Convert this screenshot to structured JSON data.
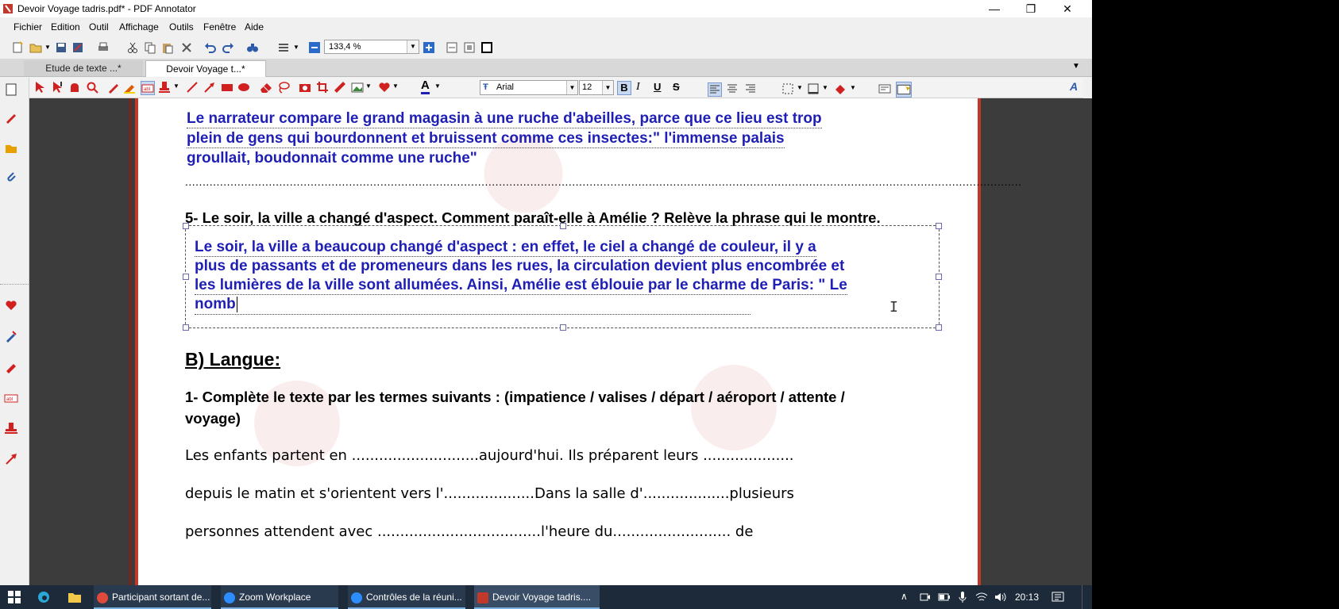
{
  "window": {
    "title": "Devoir Voyage tadris.pdf* - PDF Annotator",
    "minimize": "—",
    "restore": "❐",
    "close": "✕"
  },
  "menu": [
    "Fichier",
    "Edition",
    "Outil",
    "Affichage",
    "Outils",
    "Fenêtre",
    "Aide"
  ],
  "toolbar": {
    "zoom_value": "133,4 %"
  },
  "tabs": [
    {
      "label": "Etude de texte ...*",
      "active": false
    },
    {
      "label": "Devoir Voyage t...*",
      "active": true
    }
  ],
  "format_toolbar": {
    "font": "Arial",
    "size": "12",
    "bold": "B",
    "italic": "I",
    "underline": "U",
    "strike": "S",
    "text_color": "A",
    "right_icon": "A"
  },
  "document": {
    "answer4": [
      "Le narrateur compare le grand magasin à une ruche d'abeilles, parce que ce lieu est trop",
      "plein de gens qui bourdonnent et bruissent comme ces insectes:\" l'immense palais",
      "groullait, boudonnait comme une ruche\""
    ],
    "answer4_dots": "................................................................................................................................................................................................................................................",
    "q5": "5- Le soir, la ville a changé d'aspect. Comment paraît-elle à Amélie ? Relève la phrase qui le montre.",
    "answer5": [
      "Le soir, la ville a beaucoup changé d'aspect : en effet, le ciel a changé de couleur, il y a",
      "plus de passants et de promeneurs dans les rues, la circulation devient plus encombrée et",
      "les lumières de la ville sont allumées. Ainsi, Amélie est éblouie par le charme de Paris: \" Le",
      "nomb"
    ],
    "section_b": "B) Langue:",
    "q1_line1": "1- Complète le texte par les termes suivants : (impatience / valises / départ / aéroport / attente /",
    "q1_line2": "voyage)",
    "text_lines": [
      "Les enfants partent en ............................aujourd'hui. Ils préparent leurs ....................",
      "depuis le matin et s'orientent vers l'....................Dans la salle d'...................plusieurs",
      "personnes attendent avec ....................................l'heure du.......................... de"
    ]
  },
  "taskbar": {
    "items": [
      {
        "label": "Participant sortant de...",
        "color": "#e04a3a"
      },
      {
        "label": "Zoom Workplace",
        "color": "#2d8cff"
      },
      {
        "label": "Contrôles de la réuni...",
        "color": "#2d8cff"
      },
      {
        "label": "Devoir Voyage tadris....",
        "color": "#c0392b"
      }
    ],
    "clock": "20:13"
  }
}
